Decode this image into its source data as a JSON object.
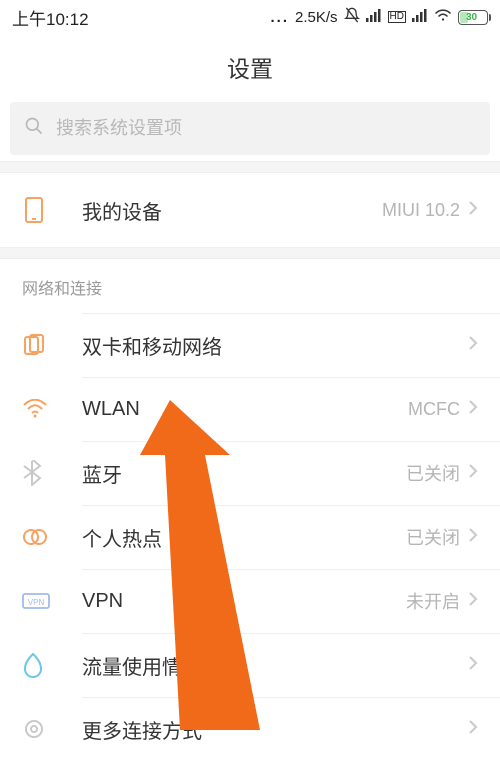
{
  "status": {
    "time": "上午10:12",
    "speed": "2.5K/s",
    "battery_text": "30"
  },
  "header": {
    "title": "设置"
  },
  "search": {
    "placeholder": "搜索系统设置项"
  },
  "device_row": {
    "label": "我的设备",
    "value": "MIUI 10.2"
  },
  "section": {
    "label": "网络和连接"
  },
  "rows": {
    "sim": {
      "label": "双卡和移动网络",
      "value": ""
    },
    "wlan": {
      "label": "WLAN",
      "value": "MCFC"
    },
    "bt": {
      "label": "蓝牙",
      "value": "已关闭"
    },
    "hotspot": {
      "label": "个人热点",
      "value": "已关闭"
    },
    "vpn": {
      "label": "VPN",
      "value": "未开启"
    },
    "traffic": {
      "label": "流量使用情况",
      "value": ""
    },
    "more": {
      "label": "更多连接方式",
      "value": ""
    }
  }
}
